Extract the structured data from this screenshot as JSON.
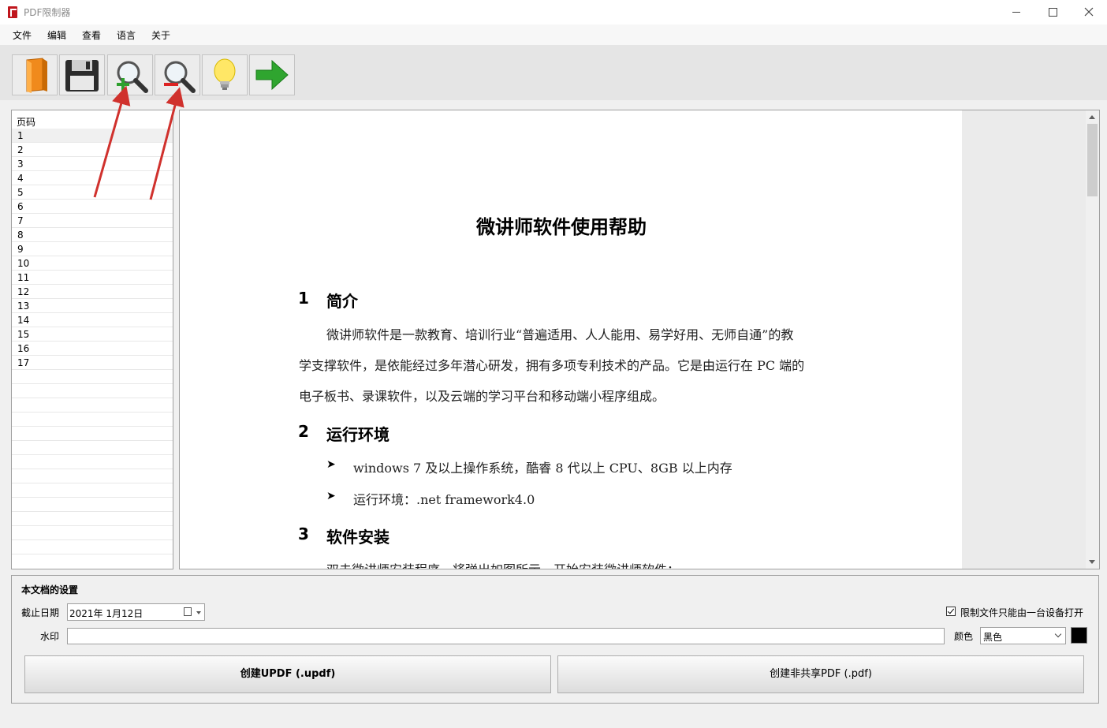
{
  "window": {
    "title": "PDF限制器"
  },
  "menu": [
    "文件",
    "编辑",
    "查看",
    "语言",
    "关于"
  ],
  "toolbar": {
    "buttons": [
      {
        "name": "open-button",
        "icon": "folder-book-icon"
      },
      {
        "name": "save-button",
        "icon": "floppy-disk-icon"
      },
      {
        "name": "zoom-in-button",
        "icon": "zoom-in-icon"
      },
      {
        "name": "zoom-out-button",
        "icon": "zoom-out-icon"
      },
      {
        "name": "help-button",
        "icon": "lightbulb-icon"
      },
      {
        "name": "next-button",
        "icon": "arrow-right-icon"
      }
    ]
  },
  "page_list": {
    "header": "页码",
    "pages": [
      "1",
      "2",
      "3",
      "4",
      "5",
      "6",
      "7",
      "8",
      "9",
      "10",
      "11",
      "12",
      "13",
      "14",
      "15",
      "16",
      "17"
    ]
  },
  "document": {
    "title": "微讲师软件使用帮助",
    "s1_num": "1",
    "s1_title": "简介",
    "p1_line1": "微讲师软件是一款教育、培训行业“普遍适用、人人能用、易学好用、无师自通”的教",
    "p1_line2": "学支撑软件，是依能经过多年潜心研发，拥有多项专利技术的产品。它是由运行在 PC 端的",
    "p1_line3": "电子板书、录课软件，以及云端的学习平台和移动端小程序组成。",
    "s2_num": "2",
    "s2_title": "运行环境",
    "b1": "windows 7 及以上操作系统，酷睿 8 代以上 CPU、8GB 以上内存",
    "b2": "运行环境：.net framework4.0",
    "s3_num": "3",
    "s3_title": "软件安装",
    "p3_line1": "双击微讲师安装程序，将弹出如图所示，开始安装微讲师软件："
  },
  "settings": {
    "legend": "本文档的设置",
    "deadline_label": "截止日期",
    "deadline_value": "2021年  1月12日",
    "watermark_label": "水印",
    "watermark_value": "",
    "restrict_label": "限制文件只能由一台设备打开",
    "restrict_checked": true,
    "color_label": "颜色",
    "color_value": "黑色",
    "swatch_color": "#000000",
    "btn_updf": "创建UPDF (.updf)",
    "btn_pdf": "创建非共享PDF (.pdf)"
  }
}
